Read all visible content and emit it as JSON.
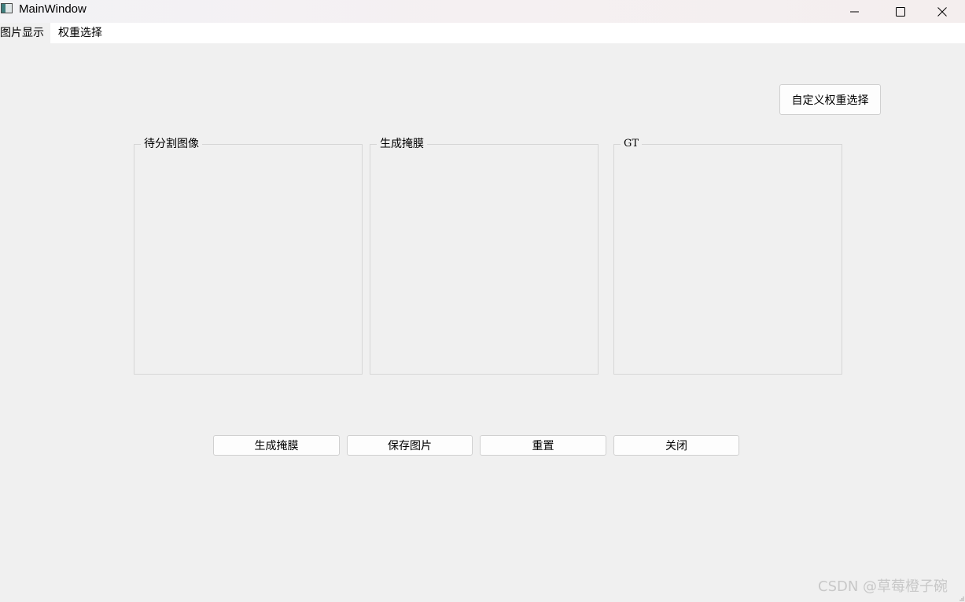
{
  "window": {
    "title": "MainWindow",
    "controls": {
      "minimize": "minimize-icon",
      "maximize": "maximize-icon",
      "close": "close-icon"
    }
  },
  "menubar": {
    "items": [
      {
        "label": "图片显示",
        "active": true
      },
      {
        "label": "权重选择",
        "active": false
      }
    ]
  },
  "toolbar": {
    "custom_weight_label": "自定义权重选择"
  },
  "panels": [
    {
      "title": "待分割图像"
    },
    {
      "title": "生成掩膜"
    },
    {
      "title": "GT"
    }
  ],
  "actions": {
    "generate_mask_label": "生成掩膜",
    "save_image_label": "保存图片",
    "reset_label": "重置",
    "close_label": "关闭"
  },
  "watermark": "CSDN @草莓橙子碗",
  "colors": {
    "background": "#f0f0f0",
    "menubar": "#ffffff",
    "button_border": "#d0d0d0",
    "panel_border": "#d6d6d6"
  }
}
